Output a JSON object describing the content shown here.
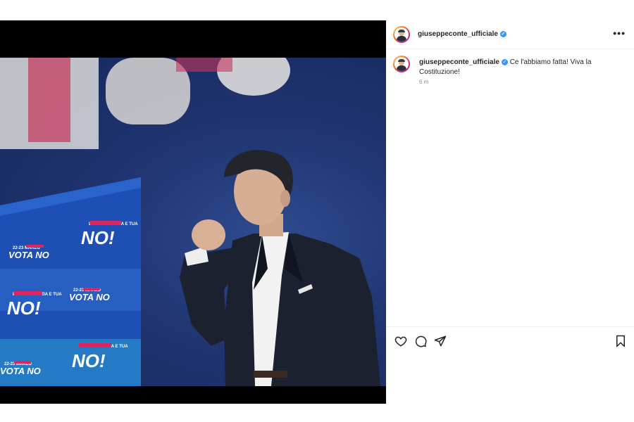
{
  "post": {
    "username": "giuseppeconte_ufficiale",
    "verified": true,
    "caption": "Ce l'abbiamo fatta! Viva la Costituzione!",
    "timestamp": "6 m"
  },
  "media": {
    "signs": [
      {
        "top_label": "LA DEMOCRAZIA E TUA",
        "text": "NO!"
      },
      {
        "top_label": "22-23 MARZO",
        "text": "VOTA NO"
      },
      {
        "top_label": "LA DEMOCRAZIA E TUA",
        "text": "NO!"
      },
      {
        "top_label": "22-23 MARZO",
        "text": "VOTA NO"
      },
      {
        "top_label": "LA DEMOCRAZIA E TUA",
        "text": "NO!"
      },
      {
        "top_label": "22-23 MARZO",
        "text": "VOTA NO"
      }
    ]
  },
  "icons": {
    "more": "more-options-icon",
    "like": "heart-icon",
    "comment": "comment-icon",
    "share": "share-icon",
    "save": "bookmark-icon"
  },
  "colors": {
    "verified": "#3897f0",
    "sign_background": "#1f4fb0",
    "sign_accent": "#e0245e"
  }
}
